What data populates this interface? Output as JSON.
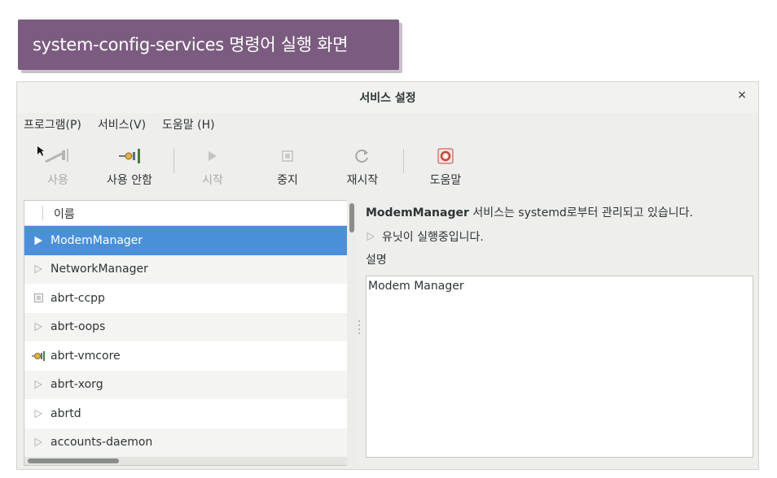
{
  "caption": "system-config-services 명령어 실행 화면",
  "window": {
    "title": "서비스 설정",
    "close": "×"
  },
  "menu": [
    "프로그램(P)",
    "서비스(V)",
    "도움말 (H)"
  ],
  "toolbar": {
    "enable": "사용",
    "disable": "사용 안함",
    "start": "시작",
    "stop": "중지",
    "restart": "재시작",
    "help": "도움말"
  },
  "list": {
    "header": "이름",
    "items": [
      {
        "name": "ModemManager",
        "icon": "play-icon",
        "selected": true
      },
      {
        "name": "NetworkManager",
        "icon": "play-icon"
      },
      {
        "name": "abrt-ccpp",
        "icon": "stop-icon"
      },
      {
        "name": "abrt-oops",
        "icon": "play-icon"
      },
      {
        "name": "abrt-vmcore",
        "icon": "plug-icon"
      },
      {
        "name": "abrt-xorg",
        "icon": "play-icon"
      },
      {
        "name": "abrtd",
        "icon": "play-icon"
      },
      {
        "name": "accounts-daemon",
        "icon": "play-icon"
      }
    ]
  },
  "detail": {
    "service_name": "ModemManager",
    "status_text": " 서비스는 systemd로부터 관리되고 있습니다.",
    "unit_status": "유닛이 실행중입니다.",
    "description_label": "설명",
    "description": "Modem Manager"
  },
  "colors": {
    "caption_bg": "#7b5c80",
    "selection": "#4a90d9"
  }
}
